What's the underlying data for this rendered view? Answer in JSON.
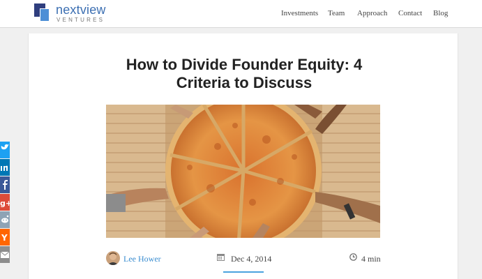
{
  "brand": {
    "name": "nextview",
    "sub": "VENTURES"
  },
  "nav": {
    "items": [
      "Investments",
      "Team",
      "Approach",
      "Contact",
      "Blog"
    ]
  },
  "article": {
    "title_line1": "How to Divide Founder Equity: 4",
    "title_line2": "Criteria to Discuss",
    "author": "Lee Hower",
    "date": "Dec 4, 2014",
    "read_time": "4 min"
  },
  "share": {
    "icons": [
      "twitter-icon",
      "linkedin-icon",
      "facebook-icon",
      "google-plus-icon",
      "reddit-icon",
      "hacker-news-icon",
      "email-icon"
    ],
    "colors": [
      "#1da1f2",
      "#0077b5",
      "#3b5998",
      "#dd4b39",
      "#8ea3b5",
      "#ff6600",
      "#8d8d8d"
    ]
  },
  "colors": {
    "link": "#3a8dd0",
    "brand_dark": "#2f3e7e",
    "brand_light": "#4d8fd6"
  }
}
